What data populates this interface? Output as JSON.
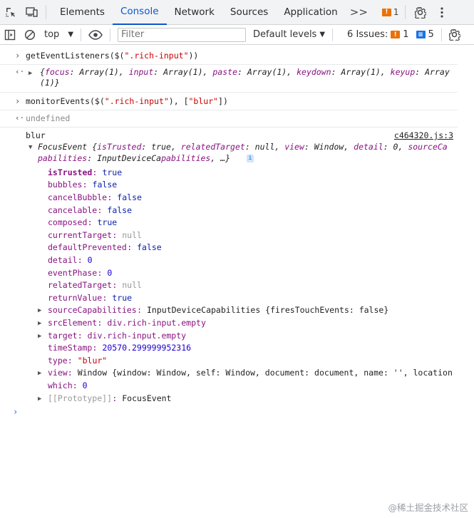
{
  "tabs": [
    "Elements",
    "Console",
    "Network",
    "Sources",
    "Application"
  ],
  "active_tab": "Console",
  "more_tabs": ">>",
  "tab_issue_count": "1",
  "toolbar": {
    "context": "top",
    "filter_placeholder": "Filter",
    "levels": "Default levels",
    "issues_label": "6 Issues:",
    "issues_warn": "1",
    "issues_info": "5"
  },
  "console": {
    "cmd1": "getEventListeners($(\".rich-input\"))",
    "res1": "{focus: Array(1), input: Array(1), paste: Array(1), keydown: Array(1), keyup: Array",
    "res1_cont": "(1)}",
    "cmd2": "monitorEvents($(\".rich-input\"), [\"blur\"])",
    "res2": "undefined",
    "log_label": "blur",
    "log_source": "c464320.js:3",
    "event_preview_1": "FocusEvent  {isTrusted: true, relatedTarget: null, view: Window, detail: 0, sourceCa",
    "event_preview_2": "pabilities: InputDeviceCapabilities,  …}",
    "props": [
      {
        "k": "isTrusted",
        "v": "true"
      },
      {
        "k": "bubbles",
        "v": "false"
      },
      {
        "k": "cancelBubble",
        "v": "false"
      },
      {
        "k": "cancelable",
        "v": "false"
      },
      {
        "k": "composed",
        "v": "true"
      },
      {
        "k": "currentTarget",
        "v": "null"
      },
      {
        "k": "defaultPrevented",
        "v": "false"
      },
      {
        "k": "detail",
        "v": "0"
      },
      {
        "k": "eventPhase",
        "v": "0"
      },
      {
        "k": "relatedTarget",
        "v": "null"
      },
      {
        "k": "returnValue",
        "v": "true"
      },
      {
        "k": "sourceCapabilities",
        "v": "InputDeviceCapabilities  {firesTouchEvents: false}"
      },
      {
        "k": "srcElement",
        "v": "div.rich-input.empty"
      },
      {
        "k": "target",
        "v": "div.rich-input.empty"
      },
      {
        "k": "timeStamp",
        "v": "20570.299999952316"
      },
      {
        "k": "type",
        "v": "\"blur\""
      },
      {
        "k": "view",
        "v": "Window  {window: Window, self: Window, document: document, name: '', location"
      },
      {
        "k": "which",
        "v": "0"
      },
      {
        "k": "[[Prototype]]",
        "v": "FocusEvent"
      }
    ]
  },
  "watermark": "@稀土掘金技术社区"
}
